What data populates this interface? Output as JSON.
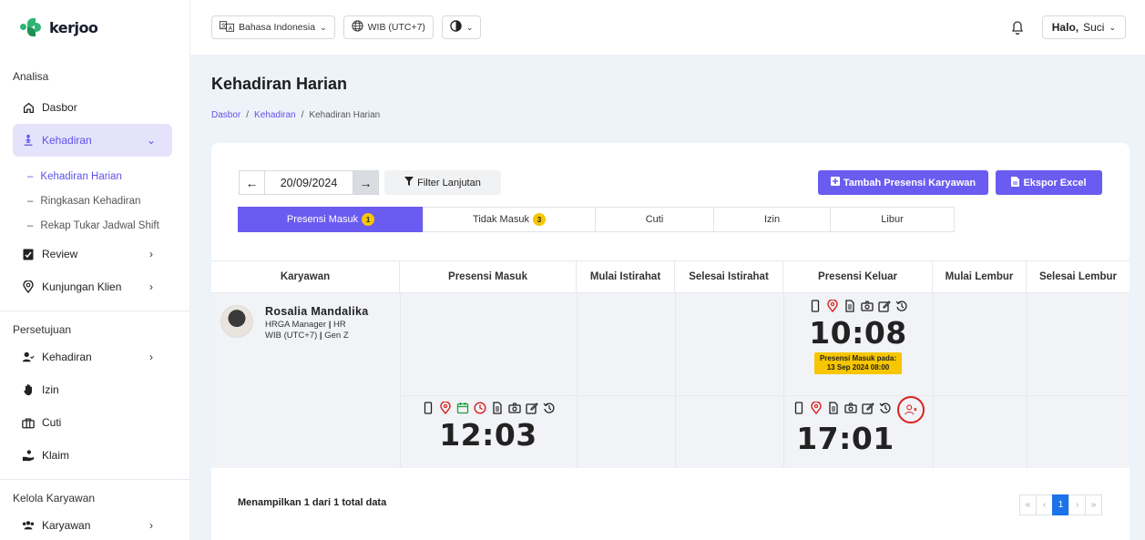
{
  "app": {
    "logo_text": "kerjoo"
  },
  "topbar": {
    "language": "Bahasa Indonesia",
    "timezone": "WIB (UTC+7)",
    "greeting": "Halo,",
    "user_name": "Suci"
  },
  "sidebar": {
    "sections": {
      "analisa": "Analisa",
      "persetujuan": "Persetujuan",
      "kelola": "Kelola Karyawan"
    },
    "analisa_items": [
      {
        "label": "Dasbor",
        "icon": "home-icon"
      },
      {
        "label": "Kehadiran",
        "icon": "attendance-icon"
      }
    ],
    "kehadiran_sub": [
      {
        "label": "Kehadiran Harian"
      },
      {
        "label": "Ringkasan Kehadiran"
      },
      {
        "label": "Rekap Tukar Jadwal Shift"
      }
    ],
    "analisa_more": [
      {
        "label": "Review",
        "icon": "clipboard-check-icon"
      },
      {
        "label": "Kunjungan Klien",
        "icon": "map-pin-icon"
      }
    ],
    "persetujuan_items": [
      {
        "label": "Kehadiran",
        "icon": "user-check-icon"
      },
      {
        "label": "Izin",
        "icon": "hand-icon"
      },
      {
        "label": "Cuti",
        "icon": "briefcase-icon"
      },
      {
        "label": "Klaim",
        "icon": "hand-coin-icon"
      }
    ],
    "kelola_items": [
      {
        "label": "Karyawan",
        "icon": "users-icon"
      }
    ]
  },
  "page": {
    "title": "Kehadiran Harian",
    "breadcrumb": [
      "Dasbor",
      "Kehadiran",
      "Kehadiran Harian"
    ]
  },
  "toolbar": {
    "date": "20/09/2024",
    "filter_label": "Filter Lanjutan",
    "add_label": "Tambah Presensi Karyawan",
    "export_label": "Ekspor Excel"
  },
  "tabs": [
    {
      "label": "Presensi Masuk",
      "badge": "1"
    },
    {
      "label": "Tidak Masuk",
      "badge": "3"
    },
    {
      "label": "Cuti"
    },
    {
      "label": "Izin"
    },
    {
      "label": "Libur"
    }
  ],
  "table": {
    "columns": [
      "Karyawan",
      "Presensi Masuk",
      "Mulai Istirahat",
      "Selesai Istirahat",
      "Presensi Keluar",
      "Mulai Lembur",
      "Selesai Lembur"
    ],
    "rows": [
      {
        "name": "Rosalia Mandalika",
        "role": "HRGA Manager",
        "dept": "HR",
        "timezone": "WIB (UTC+7)",
        "group": "Gen Z",
        "keluar_1": "10:08",
        "keluar_1_note_line1": "Presensi Masuk pada:",
        "keluar_1_note_line2": "13 Sep 2024 08:00",
        "masuk_2": "12:03",
        "keluar_2": "17:01"
      }
    ]
  },
  "footer": {
    "summary": "Menampilkan 1 dari 1 total data",
    "pager": [
      "«",
      "‹",
      "1",
      "›",
      "»"
    ]
  },
  "colors": {
    "accent": "#6a5cf0",
    "badge": "#f7c600",
    "alert": "#d92020",
    "link": "#5f52e8"
  }
}
